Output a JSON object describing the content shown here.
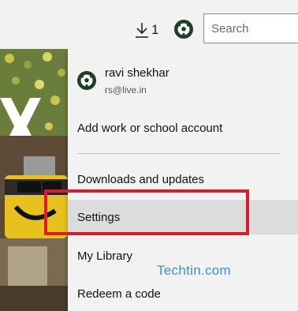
{
  "header": {
    "downloads": {
      "count": "1",
      "icon": "download-arrow-icon"
    },
    "avatar_icon": "soccer-ball-avatar-icon",
    "search": {
      "placeholder": "Search",
      "value": ""
    }
  },
  "account_menu": {
    "account": {
      "name": "ravi shekhar",
      "email": "rs@live.in",
      "avatar_icon": "soccer-ball-avatar-icon"
    },
    "items": [
      {
        "label": "Add work or school account"
      },
      {
        "label": "Downloads and updates"
      },
      {
        "label": "Settings",
        "highlighted": true
      },
      {
        "label": "My Library"
      },
      {
        "label": "Redeem a code"
      }
    ]
  },
  "annotation": {
    "highlight_color": "#d81e2a",
    "watermark": "Techtin.com",
    "watermark_color": "#3a8fd6"
  },
  "colors": {
    "menu_background": "#f2f2f2",
    "menu_highlight": "#dcdcdc"
  }
}
